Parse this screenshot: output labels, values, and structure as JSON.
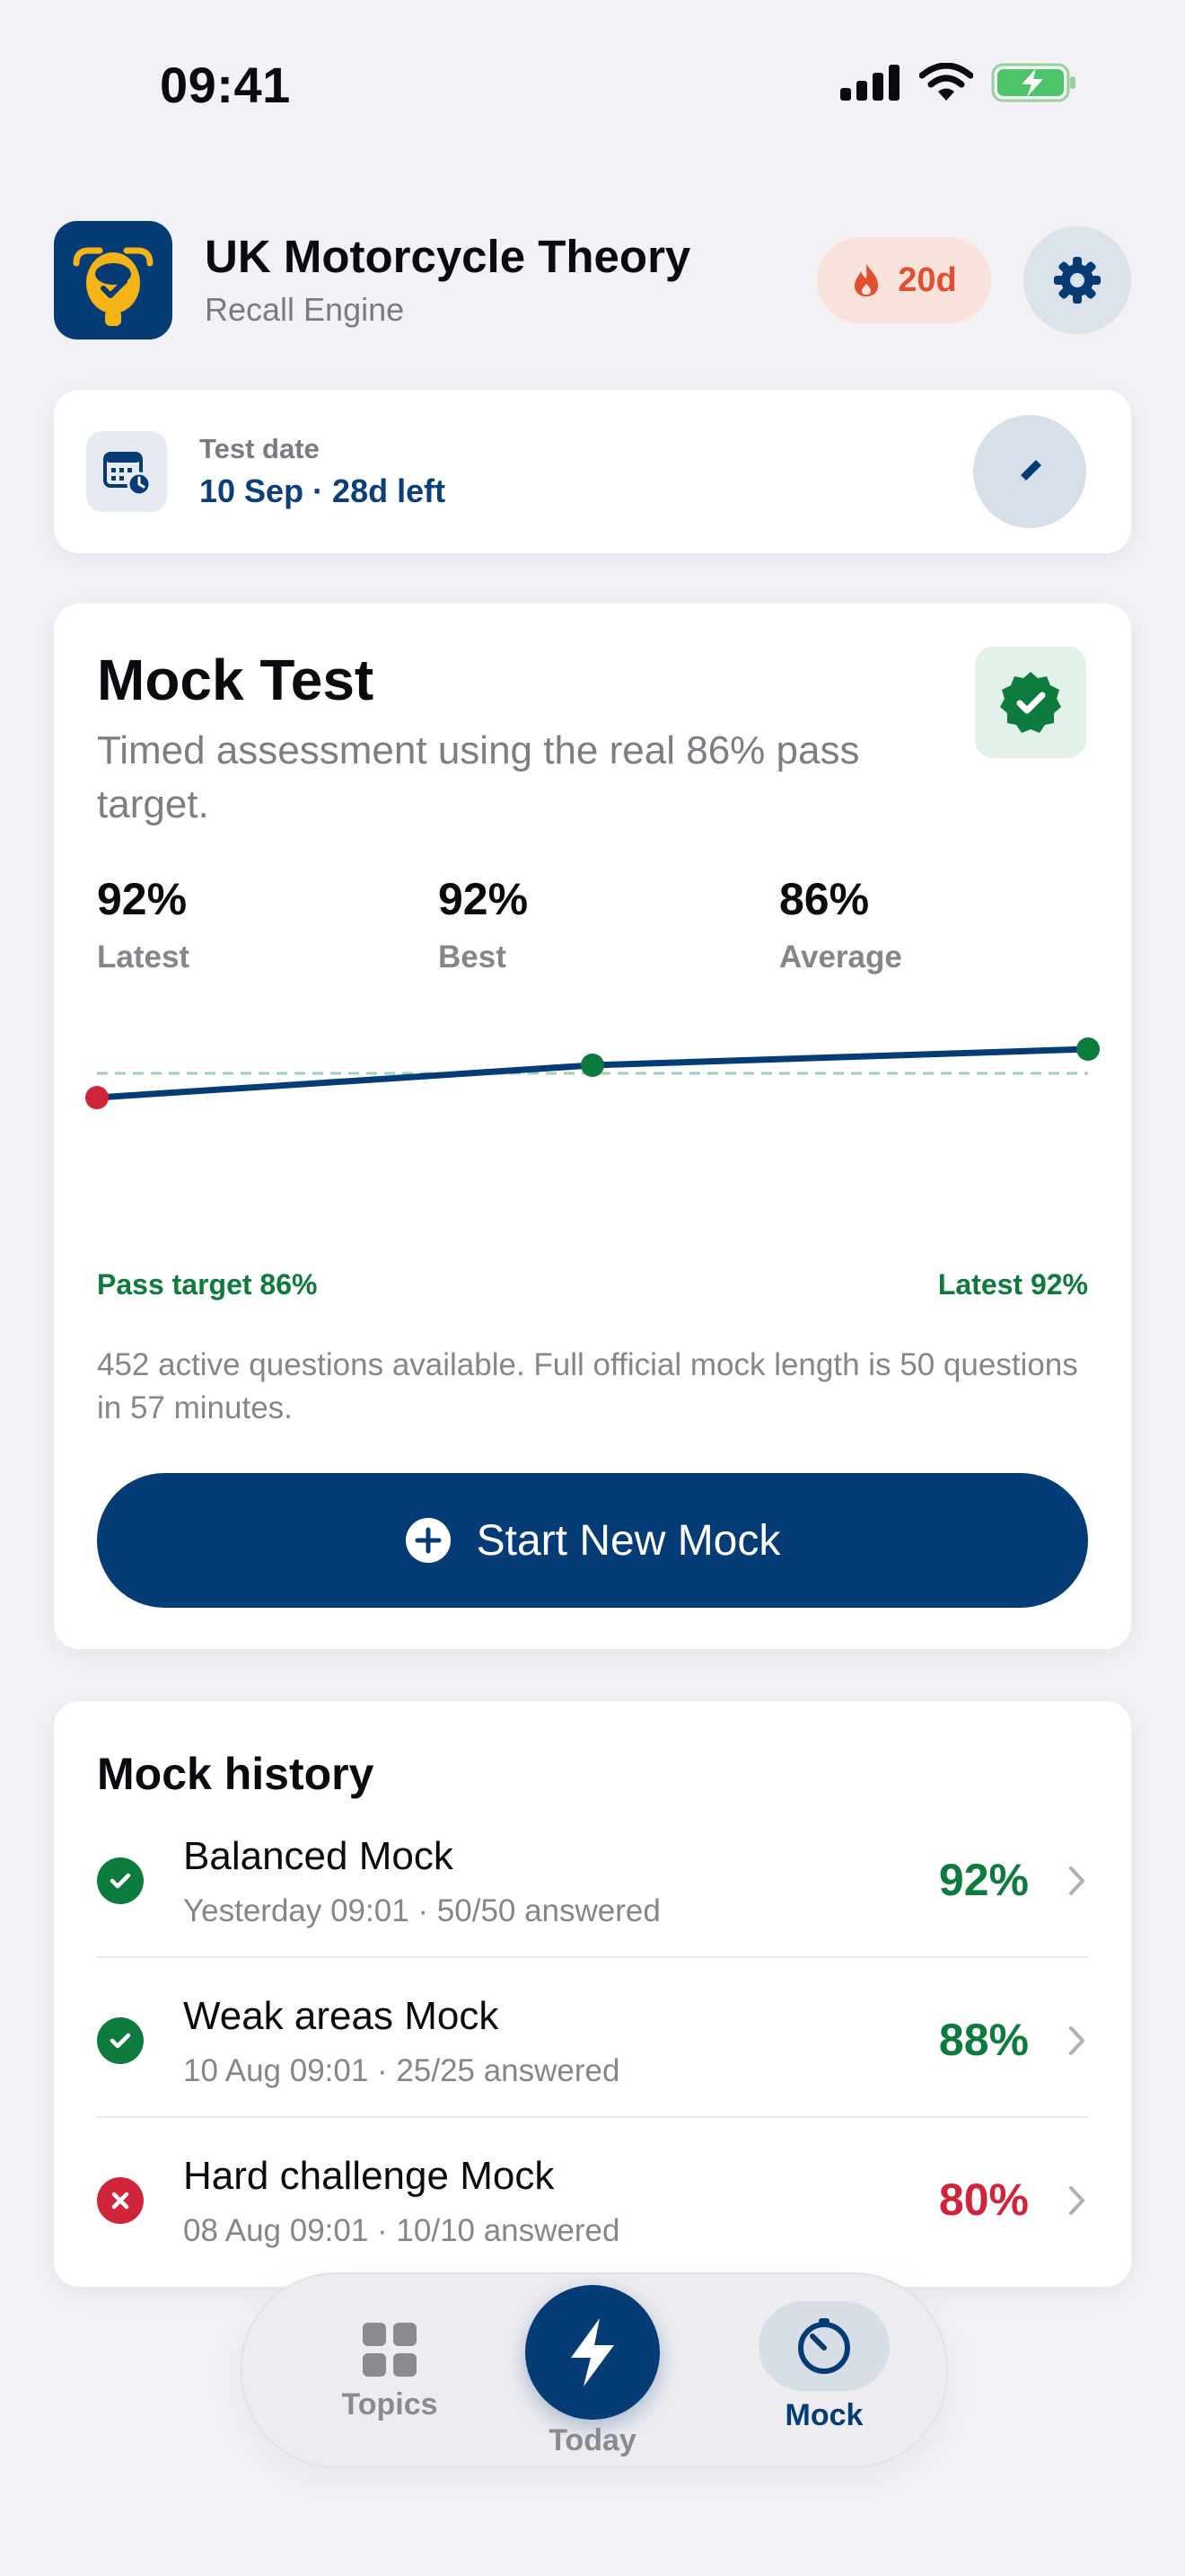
{
  "status_bar": {
    "time": "09:41"
  },
  "header": {
    "title": "UK Motorcycle Theory",
    "subtitle": "Recall Engine",
    "streak": "20d"
  },
  "test_date": {
    "label": "Test date",
    "value": "10 Sep · 28d left"
  },
  "mock": {
    "title": "Mock Test",
    "description": "Timed assessment using the real 86% pass target.",
    "stats": [
      {
        "value": "92%",
        "label": "Latest"
      },
      {
        "value": "92%",
        "label": "Best"
      },
      {
        "value": "86%",
        "label": "Average"
      }
    ],
    "trend": {
      "scores": [
        80,
        88,
        92
      ],
      "pass_target": 86,
      "point_colors": [
        "#d0243a",
        "#0d7a3e",
        "#0d7a3e"
      ]
    },
    "pass_label": "Pass target 86%",
    "latest_label": "Latest 92%",
    "info": "452 active questions available. Full official mock length is 50 questions in 57 minutes.",
    "start_label": "Start New Mock"
  },
  "history": {
    "title": "Mock history",
    "items": [
      {
        "name": "Balanced Mock",
        "meta": "Yesterday 09:01 · 50/50 answered",
        "score": "92%",
        "passed": true
      },
      {
        "name": "Weak areas Mock",
        "meta": "10 Aug 09:01 · 25/25 answered",
        "score": "88%",
        "passed": true
      },
      {
        "name": "Hard challenge Mock",
        "meta": "08 Aug 09:01 · 10/10 answered",
        "score": "80%",
        "passed": false
      }
    ]
  },
  "tabs": [
    {
      "label": "Topics",
      "icon": "grid-icon"
    },
    {
      "label": "Today",
      "icon": "bolt-icon"
    },
    {
      "label": "Mock",
      "icon": "timer-icon"
    }
  ],
  "colors": {
    "primary": "#063c75",
    "pass": "#0d7a3e",
    "fail": "#d0243a",
    "streak": "#e0502e"
  }
}
